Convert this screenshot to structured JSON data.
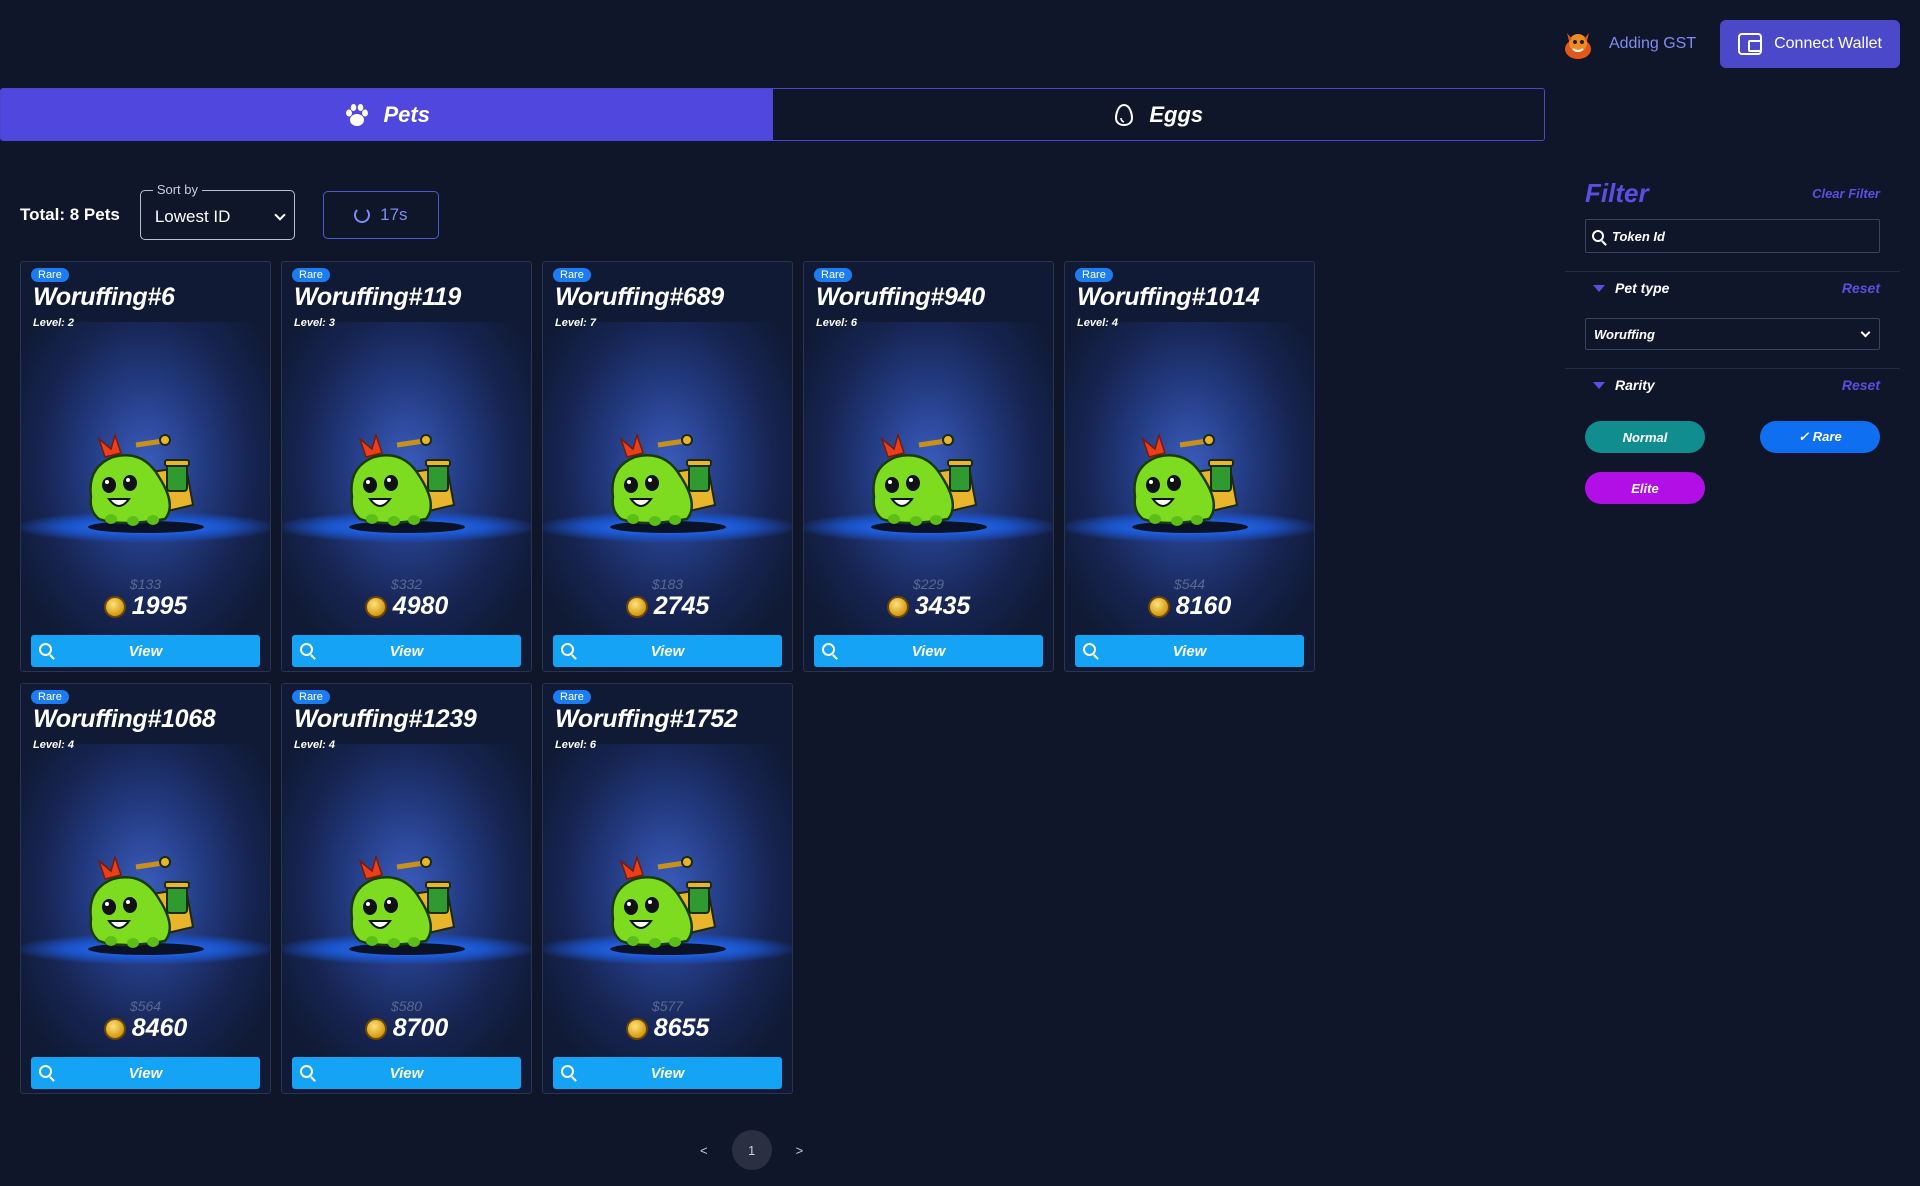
{
  "header": {
    "gst_label": "Adding GST",
    "connect_label": "Connect Wallet"
  },
  "tabs": [
    {
      "label": "Pets",
      "icon": "paw-icon",
      "active": true
    },
    {
      "label": "Eggs",
      "icon": "egg-icon",
      "active": false
    }
  ],
  "controls": {
    "total": "Total: 8 Pets",
    "sort_label": "Sort by",
    "sort_value": "Lowest ID",
    "refresh_label": "17s"
  },
  "cards": [
    {
      "rarity": "Rare",
      "name": "Woruffing#6",
      "level": "Level: 2",
      "usd": "$133",
      "price": "1995",
      "view": "View"
    },
    {
      "rarity": "Rare",
      "name": "Woruffing#119",
      "level": "Level: 3",
      "usd": "$332",
      "price": "4980",
      "view": "View"
    },
    {
      "rarity": "Rare",
      "name": "Woruffing#689",
      "level": "Level: 7",
      "usd": "$183",
      "price": "2745",
      "view": "View"
    },
    {
      "rarity": "Rare",
      "name": "Woruffing#940",
      "level": "Level: 6",
      "usd": "$229",
      "price": "3435",
      "view": "View"
    },
    {
      "rarity": "Rare",
      "name": "Woruffing#1014",
      "level": "Level: 4",
      "usd": "$544",
      "price": "8160",
      "view": "View"
    },
    {
      "rarity": "Rare",
      "name": "Woruffing#1068",
      "level": "Level: 4",
      "usd": "$564",
      "price": "8460",
      "view": "View"
    },
    {
      "rarity": "Rare",
      "name": "Woruffing#1239",
      "level": "Level: 4",
      "usd": "$580",
      "price": "8700",
      "view": "View"
    },
    {
      "rarity": "Rare",
      "name": "Woruffing#1752",
      "level": "Level: 6",
      "usd": "$577",
      "price": "8655",
      "view": "View"
    }
  ],
  "pagination": {
    "prev": "<",
    "page": "1",
    "next": ">"
  },
  "filter": {
    "title": "Filter",
    "clear": "Clear Filter",
    "token_placeholder": "Token Id",
    "pet_type": {
      "label": "Pet type",
      "reset": "Reset",
      "value": "Woruffing"
    },
    "rarity": {
      "label": "Rarity",
      "reset": "Reset",
      "options": [
        "Normal",
        "✓ Rare",
        "Elite"
      ]
    }
  },
  "colors": {
    "accent": "#5047de",
    "view_button": "#14a3f5",
    "rare": "#0e6ff0",
    "normal": "#0f8d8f",
    "elite": "#b20ee6"
  }
}
